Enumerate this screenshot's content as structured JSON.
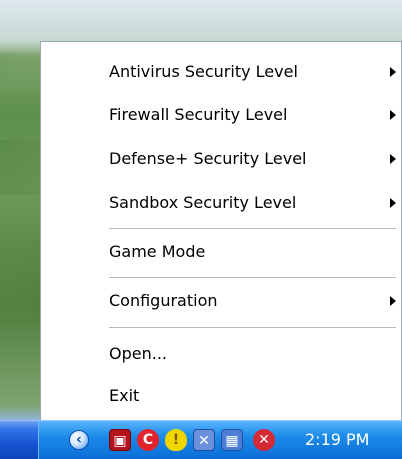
{
  "menu": {
    "items": [
      {
        "label": "Antivirus Security Level",
        "has_submenu": true
      },
      {
        "label": "Firewall Security Level",
        "has_submenu": true
      },
      {
        "label": "Defense+ Security Level",
        "has_submenu": true
      },
      {
        "label": "Sandbox Security Level",
        "has_submenu": true
      },
      {
        "label": "Game Mode",
        "has_submenu": false
      },
      {
        "label": "Configuration",
        "has_submenu": true
      },
      {
        "label": "Open...",
        "has_submenu": false
      },
      {
        "label": "Exit",
        "has_submenu": false
      }
    ]
  },
  "taskbar": {
    "clock": "2:19 PM",
    "tray_icons": [
      "comodo-shield-icon",
      "comodo-c-icon",
      "security-center-icon",
      "network-disconnected-icon",
      "network-icon",
      "security-warning-icon"
    ]
  },
  "colors": {
    "menu_background": "#ffffff",
    "taskbar_blue": "#1552d1",
    "tray_blue": "#0a6ed6"
  }
}
